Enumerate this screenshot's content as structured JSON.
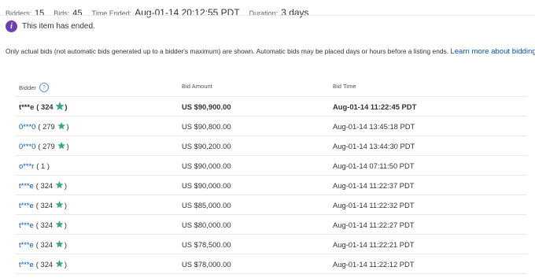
{
  "summary": {
    "bidders_label": "Bidders:",
    "bidders_value": "15",
    "bids_label": "Bids:",
    "bids_value": "45",
    "time_ended_label": "Time Ended:",
    "time_ended_value": "Aug-01-14 20:12:55 PDT",
    "duration_label": "Duration:",
    "duration_value": "3 days"
  },
  "status": {
    "text": "This item has ended.",
    "icon": "info-icon"
  },
  "note": {
    "text": "Only actual bids (not automatic bids generated up to a bidder's maximum) are shown. Automatic bids may be placed days or hours before a listing ends.",
    "link": "Learn more about bidding."
  },
  "table": {
    "headers": {
      "bidder": "Bidder",
      "amount": "Bid Amount",
      "time": "Bid Time"
    },
    "help_icon": "?",
    "rows": [
      {
        "bidder": "t***e",
        "score": "( 324",
        "star": true,
        "close": ")",
        "amount": "US $90,900.00",
        "time": "Aug-01-14 11:22:45 PDT"
      },
      {
        "bidder": "0***0",
        "score": "( 279",
        "star": true,
        "close": ")",
        "amount": "US $90,800.00",
        "time": "Aug-01-14 13:45:18 PDT"
      },
      {
        "bidder": "0***0",
        "score": "( 279",
        "star": true,
        "close": ")",
        "amount": "US $90,200.00",
        "time": "Aug-01-14 13:44:30 PDT"
      },
      {
        "bidder": "o***r",
        "score": "( 1 )",
        "star": false,
        "close": "",
        "amount": "US $90,000.00",
        "time": "Aug-01-14 07:11:50 PDT"
      },
      {
        "bidder": "t***e",
        "score": "( 324",
        "star": true,
        "close": ")",
        "amount": "US $90,000.00",
        "time": "Aug-01-14 11:22:37 PDT"
      },
      {
        "bidder": "t***e",
        "score": "( 324",
        "star": true,
        "close": ")",
        "amount": "US $85,000.00",
        "time": "Aug-01-14 11:22:32 PDT"
      },
      {
        "bidder": "t***e",
        "score": "( 324",
        "star": true,
        "close": ")",
        "amount": "US $80,000.00",
        "time": "Aug-01-14 11:22:27 PDT"
      },
      {
        "bidder": "t***e",
        "score": "( 324",
        "star": true,
        "close": ")",
        "amount": "US $78,500.00",
        "time": "Aug-01-14 11:22:21 PDT"
      },
      {
        "bidder": "t***e",
        "score": "( 324",
        "star": true,
        "close": ")",
        "amount": "US $78,000.00",
        "time": "Aug-01-14 11:22:12 PDT"
      }
    ]
  }
}
